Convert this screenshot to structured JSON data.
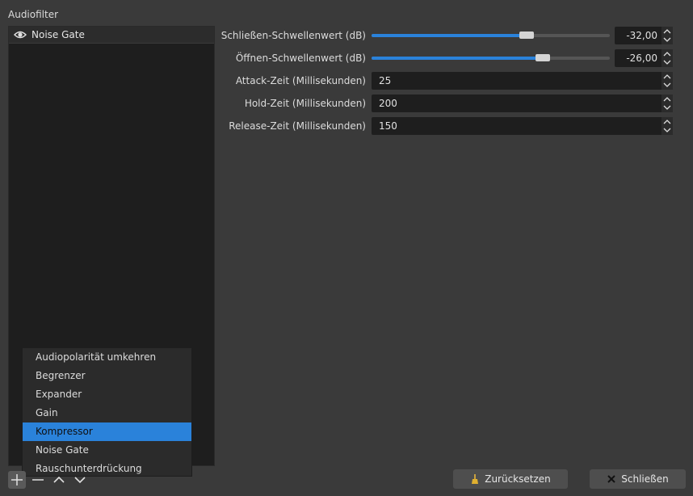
{
  "section_title": "Audiofilter",
  "filters": [
    {
      "label": "Noise Gate",
      "visible": true
    }
  ],
  "add_menu": {
    "items": [
      "Audiopolarität umkehren",
      "Begrenzer",
      "Expander",
      "Gain",
      "Kompressor",
      "Noise Gate",
      "Rauschunterdrückung"
    ],
    "selected": "Kompressor"
  },
  "properties": {
    "close_threshold": {
      "label": "Schließen-Schwellenwert (dB)",
      "value": "-32,00",
      "fraction": 0.65
    },
    "open_threshold": {
      "label": "Öffnen-Schwellenwert (dB)",
      "value": "-26,00",
      "fraction": 0.72
    },
    "attack": {
      "label": "Attack-Zeit (Millisekunden)",
      "value": "25"
    },
    "hold": {
      "label": "Hold-Zeit (Millisekunden)",
      "value": "200"
    },
    "release": {
      "label": "Release-Zeit (Millisekunden)",
      "value": "150"
    }
  },
  "buttons": {
    "reset": "Zurücksetzen",
    "close": "Schließen"
  },
  "colors": {
    "accent": "#2a82da",
    "background": "#3a3a3a",
    "panel": "#1e1e1e"
  }
}
